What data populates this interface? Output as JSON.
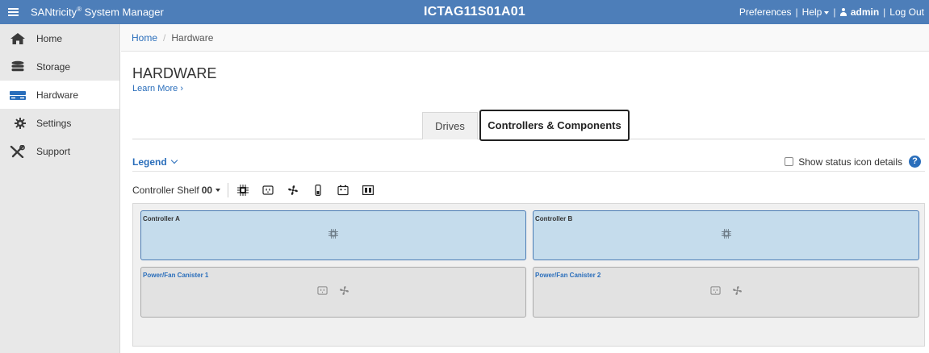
{
  "topbar": {
    "brand": "SANtricity",
    "brand_mark": "®",
    "brand_suffix": " System Manager",
    "system_name": "ICTAG11S01A01",
    "preferences": "Preferences",
    "help": "Help",
    "user": "admin",
    "logout": "Log Out"
  },
  "sidebar": {
    "items": [
      {
        "label": "Home",
        "icon": "home-icon"
      },
      {
        "label": "Storage",
        "icon": "storage-icon"
      },
      {
        "label": "Hardware",
        "icon": "hardware-icon",
        "active": true
      },
      {
        "label": "Settings",
        "icon": "gear-icon"
      },
      {
        "label": "Support",
        "icon": "tools-icon"
      }
    ]
  },
  "breadcrumb": {
    "home": "Home",
    "separator": "/",
    "current": "Hardware"
  },
  "page": {
    "title": "HARDWARE",
    "learn_more": "Learn More",
    "learn_more_glyph": "›",
    "tabs": [
      {
        "label": "Drives",
        "selected": false
      },
      {
        "label": "Controllers & Components",
        "selected": true
      }
    ],
    "legend": "Legend",
    "status_details": "Show status icon details",
    "help_glyph": "?"
  },
  "shelf": {
    "selector_label": "Controller Shelf",
    "selector_value": "00",
    "toolbar_icons": [
      "chip-icon",
      "power-supply-icon",
      "fan-icon",
      "temperature-sensor-icon",
      "battery-icon",
      "sfp-icon"
    ],
    "components": [
      {
        "label": "Controller A",
        "type": "controller",
        "icons": [
          "chip-icon"
        ]
      },
      {
        "label": "Controller B",
        "type": "controller",
        "icons": [
          "chip-icon"
        ]
      },
      {
        "label": "Power/Fan Canister 1",
        "type": "power-fan",
        "icons": [
          "power-supply-icon",
          "fan-icon"
        ]
      },
      {
        "label": "Power/Fan Canister 2",
        "type": "power-fan",
        "icons": [
          "power-supply-icon",
          "fan-icon"
        ]
      }
    ]
  },
  "colors": {
    "topbar": "#4d7eb9",
    "link": "#2a6ebb",
    "controller_fill": "#c5dcec",
    "controller_border": "#4a7bb4",
    "canister_fill": "#e2e2e2"
  }
}
